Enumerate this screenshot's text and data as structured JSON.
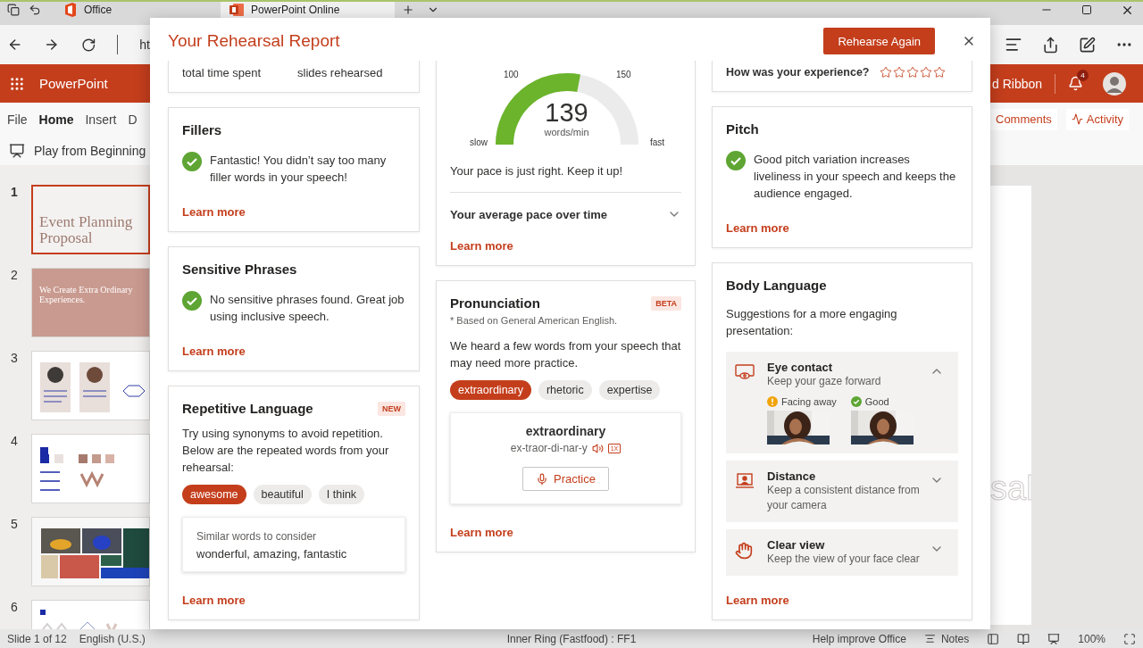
{
  "browser": {
    "tabs": [
      {
        "label": "Office",
        "selected": false
      },
      {
        "label": "PowerPoint Online",
        "selected": true
      }
    ],
    "address": "ht"
  },
  "app": {
    "name": "PowerPoint",
    "ribbon_toggle": "d Ribbon",
    "notification_count": "4"
  },
  "menu": [
    {
      "label": "File",
      "selected": false
    },
    {
      "label": "Home",
      "selected": true
    },
    {
      "label": "Insert",
      "selected": false
    },
    {
      "label": "D",
      "selected": false
    }
  ],
  "menu_actions": [
    {
      "kind": "comments",
      "label": "Comments"
    },
    {
      "kind": "activity",
      "label": "Activity"
    }
  ],
  "toolbar": {
    "play": "Play from Beginning"
  },
  "slides": [
    {
      "number": "1",
      "selected": true,
      "kind": "title",
      "title": "Event Planning Proposal"
    },
    {
      "number": "2",
      "selected": false,
      "kind": "statement",
      "title": "We Create Extra Ordinary Experiences."
    },
    {
      "number": "3",
      "selected": false,
      "kind": "team"
    },
    {
      "number": "4",
      "selected": false,
      "kind": "palette"
    },
    {
      "number": "5",
      "selected": false,
      "kind": "photos"
    },
    {
      "number": "6",
      "selected": false,
      "kind": "pattern"
    }
  ],
  "canvas": {
    "title_fragment": "sal"
  },
  "status_bar": {
    "slide": "Slide 1 of 12",
    "language": "English (U.S.)",
    "build": "Inner Ring (Fastfood) : FF1",
    "feedback": "Help improve Office",
    "notes": "Notes",
    "zoom": "100%"
  },
  "report": {
    "title": "Your Rehearsal Report",
    "primary_action": "Rehearse Again",
    "columns": [
      [
        {
          "kind": "summary",
          "labels": [
            "total time spent",
            "slides rehearsed"
          ]
        },
        {
          "kind": "result",
          "title": "Fillers",
          "message": "Fantastic! You didn’t say too many filler words in your speech!",
          "link": "Learn more"
        },
        {
          "kind": "result",
          "title": "Sensitive Phrases",
          "message": "No sensitive phrases found. Great job using inclusive speech.",
          "link": "Learn more"
        },
        {
          "kind": "words",
          "title": "Repetitive Language",
          "badge": "NEW",
          "message": "Try using synonyms to avoid repetition. Below are the repeated words from your rehearsal:",
          "chips": [
            {
              "label": "awesome",
              "selected": true
            },
            {
              "label": "beautiful",
              "selected": false
            },
            {
              "label": "I think",
              "selected": false
            }
          ],
          "detail": {
            "heading": "Similar words to consider",
            "value": "wonderful, amazing, fantastic"
          },
          "link": "Learn more"
        }
      ],
      [
        {
          "kind": "pace",
          "gauge": {
            "level": 0.56,
            "value": "139",
            "unit": "words/min",
            "min_label": "slow",
            "max_label": "fast",
            "ticks": [
              "100",
              "150"
            ]
          },
          "message": "Your pace is just right. Keep it up!",
          "expander": {
            "label": "Your average pace over time",
            "expanded": false
          },
          "link": "Learn more"
        },
        {
          "kind": "pronunciation",
          "title": "Pronunciation",
          "badge": "BETA",
          "note": "* Based on General American English.",
          "message": "We heard a few words from your speech that may need more practice.",
          "chips": [
            {
              "label": "extraordinary",
              "selected": true
            },
            {
              "label": "rhetoric",
              "selected": false
            },
            {
              "label": "expertise",
              "selected": false
            }
          ],
          "detail": {
            "word": "extraordinary",
            "syllables": "ex-traor-di-nar-y",
            "speed": "1X",
            "action": "Practice"
          },
          "link": "Learn more"
        }
      ],
      [
        {
          "kind": "rating",
          "question": "How was your experience?",
          "stars": 0
        },
        {
          "kind": "result",
          "title": "Pitch",
          "message": "Good pitch variation increases liveliness in your speech and keeps the audience engaged.",
          "link": "Learn more"
        },
        {
          "kind": "body",
          "title": "Body Language",
          "message": "Suggestions for a more engaging presentation:",
          "tips": [
            {
              "kind": "eye",
              "title": "Eye contact",
              "subtitle": "Keep your gaze forward",
              "expanded": true,
              "examples": [
                {
                  "kind": "warning",
                  "label": "Facing away"
                },
                {
                  "kind": "good",
                  "label": "Good"
                }
              ]
            },
            {
              "kind": "distance",
              "title": "Distance",
              "subtitle": "Keep a consistent distance from your camera",
              "expanded": false
            },
            {
              "kind": "view",
              "title": "Clear view",
              "subtitle": "Keep the view of your face clear",
              "expanded": false
            }
          ],
          "link": "Learn more"
        }
      ]
    ]
  }
}
